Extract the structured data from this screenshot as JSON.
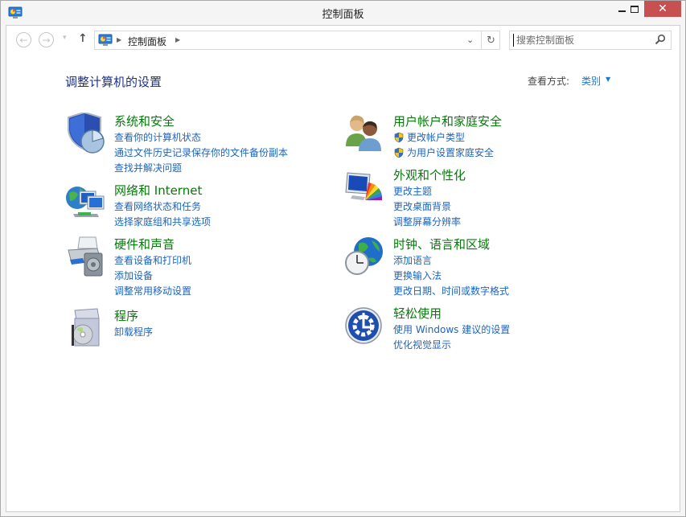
{
  "window": {
    "title": "控制面板",
    "controls": {
      "minimize": "minimize",
      "maximize": "maximize",
      "close": "✕"
    }
  },
  "navbar": {
    "back": "←",
    "forward": "→",
    "recent": "▾",
    "up": "↑",
    "address": {
      "crumbs": [
        "控制面板"
      ],
      "dropdown": "⌄",
      "refresh": "↻"
    },
    "search": {
      "placeholder": "搜索控制面板",
      "value": ""
    }
  },
  "main": {
    "title": "调整计算机的设置",
    "view_by": {
      "label": "查看方式:",
      "value": "类别",
      "arrow": "▼"
    },
    "categories": [
      {
        "id": "system-security",
        "icon": "shield-chart-icon",
        "title": "系统和安全",
        "links": [
          {
            "label": "查看你的计算机状态",
            "shield": false
          },
          {
            "label": "通过文件历史记录保存你的文件备份副本",
            "shield": false
          },
          {
            "label": "查找并解决问题",
            "shield": false
          }
        ]
      },
      {
        "id": "network-internet",
        "icon": "network-globe-icon",
        "title": "网络和 Internet",
        "links": [
          {
            "label": "查看网络状态和任务",
            "shield": false
          },
          {
            "label": "选择家庭组和共享选项",
            "shield": false
          }
        ]
      },
      {
        "id": "hardware-sound",
        "icon": "printer-speaker-icon",
        "title": "硬件和声音",
        "links": [
          {
            "label": "查看设备和打印机",
            "shield": false
          },
          {
            "label": "添加设备",
            "shield": false
          },
          {
            "label": "调整常用移动设置",
            "shield": false
          }
        ]
      },
      {
        "id": "programs",
        "icon": "program-box-icon",
        "title": "程序",
        "links": [
          {
            "label": "卸载程序",
            "shield": false
          }
        ]
      },
      {
        "id": "user-accounts",
        "icon": "users-icon",
        "title": "用户帐户和家庭安全",
        "links": [
          {
            "label": "更改帐户类型",
            "shield": true
          },
          {
            "label": "为用户设置家庭安全",
            "shield": true
          }
        ]
      },
      {
        "id": "appearance",
        "icon": "monitor-palette-icon",
        "title": "外观和个性化",
        "links": [
          {
            "label": "更改主题",
            "shield": false
          },
          {
            "label": "更改桌面背景",
            "shield": false
          },
          {
            "label": "调整屏幕分辨率",
            "shield": false
          }
        ]
      },
      {
        "id": "clock-region",
        "icon": "clock-globe-icon",
        "title": "时钟、语言和区域",
        "links": [
          {
            "label": "添加语言",
            "shield": false
          },
          {
            "label": "更换输入法",
            "shield": false
          },
          {
            "label": "更改日期、时间或数字格式",
            "shield": false
          }
        ]
      },
      {
        "id": "ease-of-access",
        "icon": "ease-of-access-icon",
        "title": "轻松使用",
        "links": [
          {
            "label": "使用 Windows 建议的设置",
            "shield": false
          },
          {
            "label": "优化视觉显示",
            "shield": false
          }
        ]
      }
    ]
  },
  "colors": {
    "category_title": "#067a0a",
    "link": "#1e64be",
    "page_title": "#1e3287",
    "close_button": "#c75050"
  }
}
